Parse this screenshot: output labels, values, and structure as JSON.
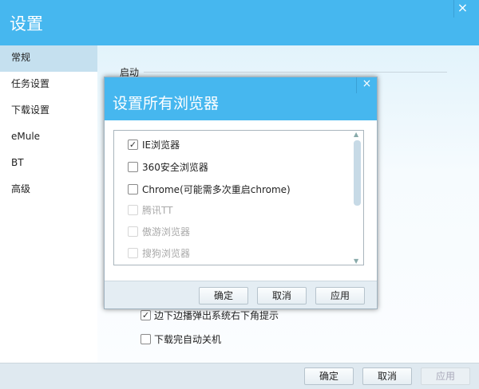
{
  "window": {
    "title": "设置",
    "close_icon": "×"
  },
  "sidebar": {
    "items": [
      {
        "label": "常规",
        "selected": true
      },
      {
        "label": "任务设置"
      },
      {
        "label": "下载设置"
      },
      {
        "label": "eMule"
      },
      {
        "label": "BT"
      },
      {
        "label": "高级"
      }
    ]
  },
  "content": {
    "section": "启动",
    "options": [
      {
        "label": "边下边播弹出系统右下角提示",
        "checked": true
      },
      {
        "label": "下载完自动关机",
        "checked": false
      }
    ]
  },
  "footer": {
    "ok": "确定",
    "cancel": "取消",
    "apply": "应用"
  },
  "dialog": {
    "title": "设置所有浏览器",
    "close_icon": "×",
    "browsers": [
      {
        "label": "IE浏览器",
        "checked": true,
        "enabled": true
      },
      {
        "label": "360安全浏览器",
        "checked": false,
        "enabled": true
      },
      {
        "label": "Chrome(可能需多次重启chrome)",
        "checked": false,
        "enabled": true
      },
      {
        "label": "腾讯TT",
        "checked": false,
        "enabled": false
      },
      {
        "label": "傲游浏览器",
        "checked": false,
        "enabled": false
      },
      {
        "label": "搜狗浏览器",
        "checked": false,
        "enabled": false
      }
    ],
    "ok": "确定",
    "cancel": "取消",
    "apply": "应用"
  },
  "colors": {
    "accent": "#46b7ef"
  }
}
